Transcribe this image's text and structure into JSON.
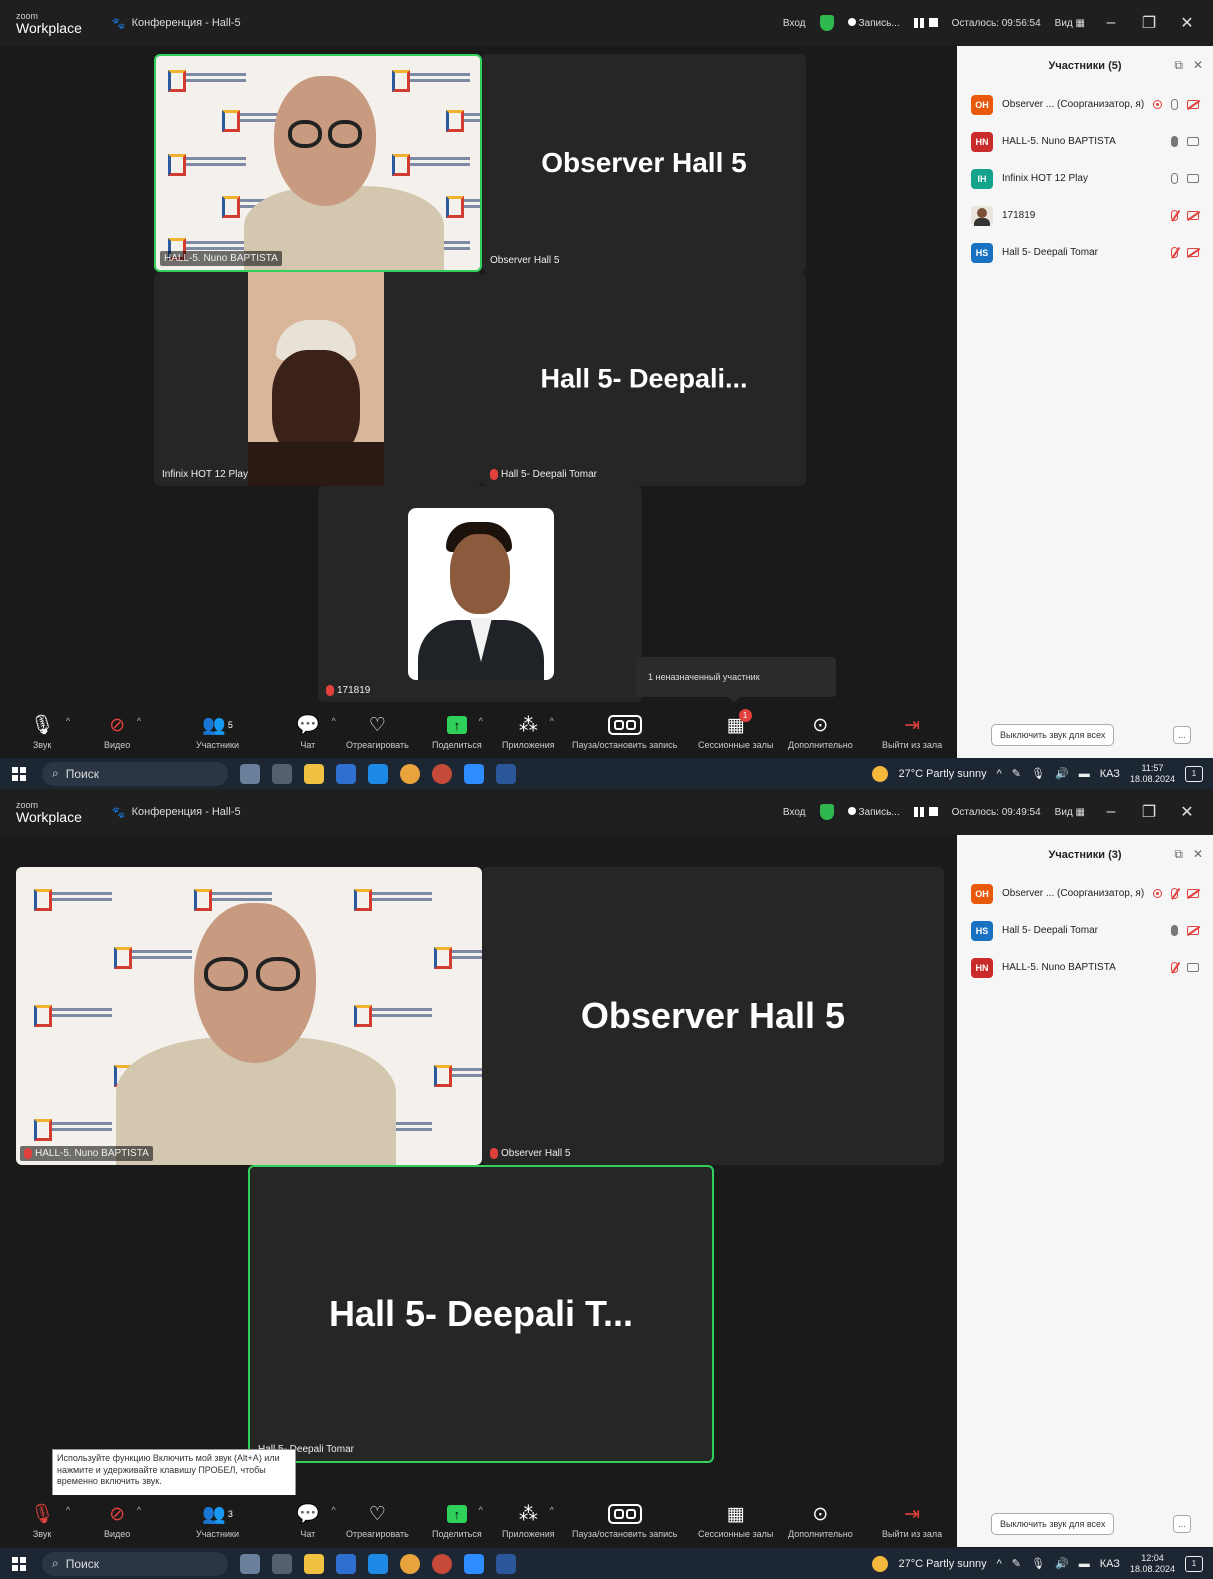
{
  "app": {
    "brand_top": "zoom",
    "brand_bottom": "Workplace"
  },
  "shots": [
    {
      "titlebar": {
        "meeting_title": "Конференция - Hall-5",
        "signin": "Вход",
        "recording": "Запись...",
        "time_left": "Осталось: 09:56:54",
        "view": "Вид"
      },
      "tiles": {
        "nuno_name": "HALL-5. Nuno BAPTISTA",
        "observer_big": "Observer Hall 5",
        "observer_tag": "Observer Hall 5",
        "infinix_tag": "Infinix HOT 12 Play",
        "deepali_big": "Hall 5- Deepali...",
        "deepali_tag": "Hall 5- Deepali Tomar",
        "p171819_tag": "171819"
      },
      "tooltip_unassigned": "1 неназначенный участник",
      "panel": {
        "title": "Участники (5)",
        "participants": [
          {
            "initials": "OH",
            "name": "Observer ... (Соорганизатор, я)",
            "color": "#e8590c"
          },
          {
            "initials": "HN",
            "name": "HALL-5. Nuno BAPTISTA",
            "color": "#c92a2a"
          },
          {
            "initials": "IH",
            "name": "Infinix HOT 12 Play",
            "color": "#12a38a"
          },
          {
            "initials": "",
            "name": "171819",
            "color": "#e9e4dc"
          },
          {
            "initials": "HS",
            "name": "Hall 5- Deepali Tomar",
            "color": "#1971c2"
          }
        ],
        "mute_all": "Выключить звук для всех",
        "more": "..."
      },
      "toolbar": {
        "audio": "Звук",
        "video": "Видео",
        "participants": "Участники",
        "participants_count": "5",
        "chat": "Чат",
        "react": "Отреагировать",
        "share": "Поделиться",
        "apps": "Приложения",
        "record": "Пауза/остановить запись",
        "breakout": "Сессионные залы",
        "breakout_badge": "1",
        "more": "Дополнительно",
        "leave": "Выйти из зала"
      },
      "taskbar": {
        "search": "Поиск",
        "weather": "27°C Partly sunny",
        "lang": "КАЗ",
        "time": "11:57",
        "date": "18.08.2024",
        "notif_count": "1"
      }
    },
    {
      "titlebar": {
        "meeting_title": "Конференция - Hall-5",
        "signin": "Вход",
        "recording": "Запись...",
        "time_left": "Осталось: 09:49:54",
        "view": "Вид"
      },
      "tiles": {
        "nuno_name": "HALL-5. Nuno BAPTISTA",
        "observer_big": "Observer Hall 5",
        "observer_tag": "Observer Hall 5",
        "deepali_big": "Hall 5- Deepali T...",
        "deepali_tag": "Hall 5- Deepali Tomar"
      },
      "tooltip_mute": "Используйте функцию Включить мой звук (Alt+A) или нажмите и удерживайте клавишу ПРОБЕЛ, чтобы временно включить звук.",
      "panel": {
        "title": "Участники (3)",
        "participants": [
          {
            "initials": "OH",
            "name": "Observer ... (Соорганизатор, я)",
            "color": "#e8590c"
          },
          {
            "initials": "HS",
            "name": "Hall 5- Deepali Tomar",
            "color": "#1971c2"
          },
          {
            "initials": "HN",
            "name": "HALL-5. Nuno BAPTISTA",
            "color": "#c92a2a"
          }
        ],
        "mute_all": "Выключить звук для всех",
        "more": "..."
      },
      "toolbar": {
        "audio": "Звук",
        "video": "Видео",
        "participants": "Участники",
        "participants_count": "3",
        "chat": "Чат",
        "react": "Отреагировать",
        "share": "Поделиться",
        "apps": "Приложения",
        "record": "Пауза/остановить запись",
        "breakout": "Сессионные залы",
        "more": "Дополнительно",
        "leave": "Выйти из зала"
      },
      "taskbar": {
        "search": "Поиск",
        "weather": "27°C Partly sunny",
        "lang": "КАЗ",
        "time": "12:04",
        "date": "18.08.2024",
        "notif_count": "1"
      }
    }
  ]
}
